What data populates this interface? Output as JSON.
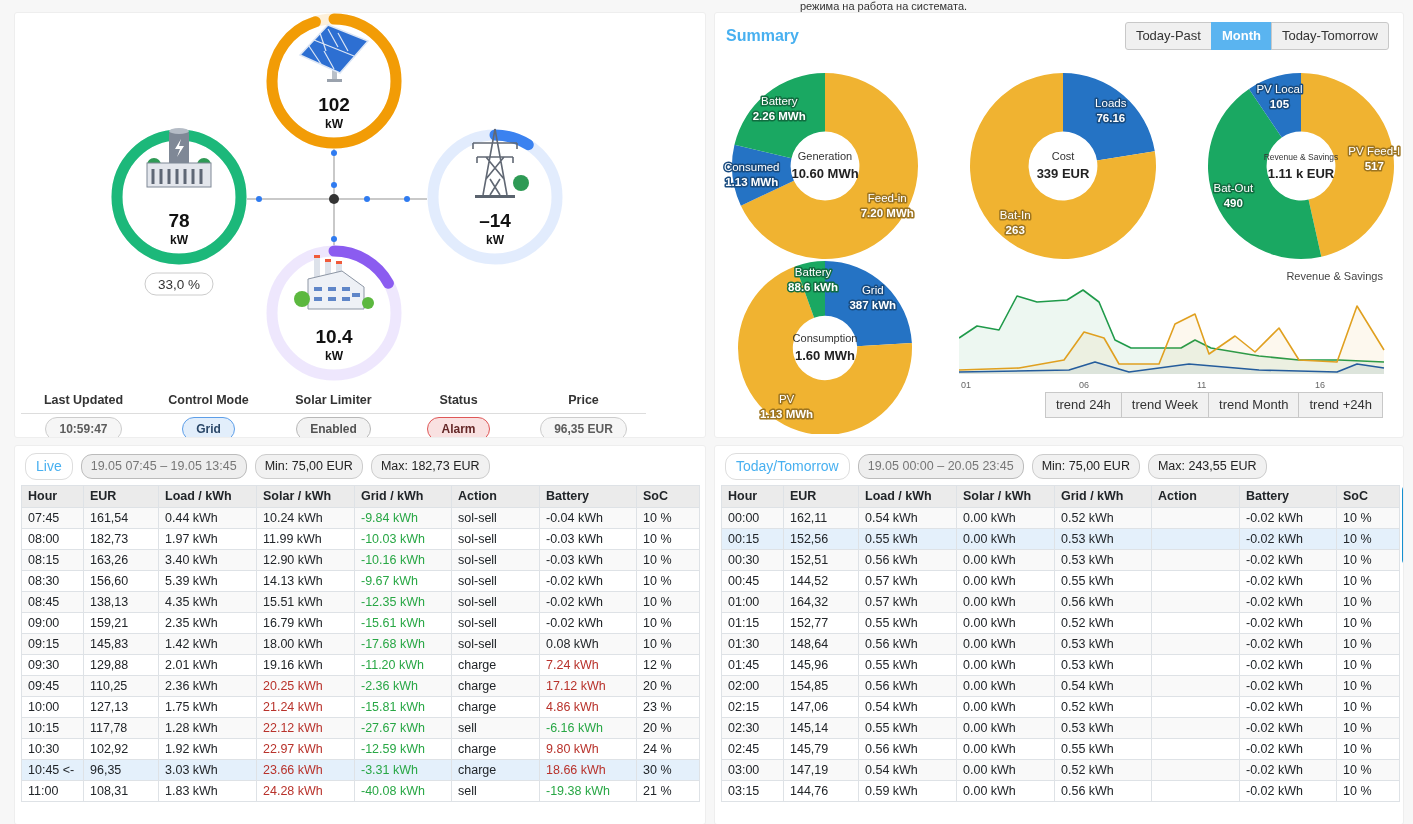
{
  "top_note": "режима на работа на системата.",
  "flow": {
    "nodes": [
      {
        "kind": "solar",
        "value": "102",
        "unit": "kW"
      },
      {
        "kind": "battery",
        "value": "78",
        "unit": "kW",
        "soc": "33,0 %"
      },
      {
        "kind": "grid",
        "value": "–14",
        "unit": "kW"
      },
      {
        "kind": "load",
        "value": "10.4",
        "unit": "kW"
      }
    ]
  },
  "status": [
    {
      "label": "Last Updated",
      "value": "10:59:47",
      "color": "#cccccc"
    },
    {
      "label": "Control Mode",
      "value": "Grid",
      "color": "#5d9ee8"
    },
    {
      "label": "Solar Limiter",
      "value": "Enabled",
      "color": "#b8b8b8"
    },
    {
      "label": "Status",
      "value": "Alarm",
      "color": "#df5757"
    },
    {
      "label": "Price",
      "value": "96,35 EUR",
      "color": "#cccccc"
    }
  ],
  "summary": {
    "title": "Summary",
    "periods": [
      {
        "label": "Today-Past",
        "selected": false
      },
      {
        "label": "Month",
        "selected": true
      },
      {
        "label": "Today-Tomorrow",
        "selected": false
      }
    ],
    "donuts": [
      {
        "total": "10.60 MWh",
        "slices": [
          {
            "color": "#f0b331"
          },
          {
            "color": "#2573c4"
          },
          {
            "color": "#1aa862"
          }
        ],
        "chart_data": {
          "type": "donut",
          "title": "Generation",
          "categories": [
            "Feed-in",
            "Consumed",
            "Battery"
          ],
          "values": [
            7.2,
            1.13,
            2.26
          ],
          "value_labels": [
            "7.20 MWh",
            "1.13 MWh",
            "2.26 MWh"
          ]
        }
      },
      {
        "total": "339 EUR",
        "slices": [
          {
            "color": "#2573c4"
          },
          {
            "color": "#f0b331"
          }
        ],
        "chart_data": {
          "type": "donut",
          "title": "Cost",
          "categories": [
            "Loads",
            "Bat-In"
          ],
          "values": [
            76.16,
            263
          ],
          "value_labels": [
            "76.16",
            "263"
          ]
        }
      },
      {
        "total": "1.11 k EUR",
        "slices": [
          {
            "color": "#f0b331"
          },
          {
            "color": "#1aa862"
          },
          {
            "color": "#2573c4"
          }
        ],
        "chart_data": {
          "type": "donut",
          "title": "Revenue & Savings",
          "categories": [
            "PV Feed-I",
            "Bat-Out",
            "PV Local"
          ],
          "values": [
            517,
            490,
            105
          ],
          "value_labels": [
            "517",
            "490",
            "105"
          ]
        }
      },
      {
        "total": "1.60 MWh",
        "slices": [
          {
            "color": "#2573c4",
            "value_text": "387 kWh"
          },
          {
            "color": "#f0b331",
            "value_text": "1.13 MWh"
          },
          {
            "color": "#1aa862",
            "value_text": "88.6 kWh"
          }
        ],
        "chart_data": {
          "type": "donut",
          "title": "Consumption",
          "categories": [
            "Grid",
            "PV",
            "Battery"
          ],
          "values": [
            24.1,
            70.4,
            5.5
          ]
        }
      }
    ],
    "trend": {
      "title": "Revenue & Savings",
      "x_labels": [
        "01",
        "06",
        "11",
        "16"
      ],
      "buttons": [
        {
          "label": "trend 24h",
          "selected": false
        },
        {
          "label": "trend Week",
          "selected": false
        },
        {
          "label": "trend Month",
          "selected": false
        },
        {
          "label": "trend +24h",
          "selected": false
        }
      ]
    }
  },
  "tables": [
    {
      "title": "Live",
      "range": "19.05 07:45 – 19.05 13:45",
      "min": "Min: 75,00 EUR",
      "max": "Max: 182,73 EUR",
      "columns": [
        "Hour",
        "EUR",
        "Load / kWh",
        "Solar / kWh",
        "Grid / kWh",
        "Action",
        "Battery",
        "SoC"
      ],
      "rows": [
        {
          "selected": false,
          "cells": [
            "07:45",
            "161,54",
            "0.44 kWh",
            "10.24 kWh",
            {
              "text": "-9.84 kWh",
              "color": "#28a745"
            },
            "sol-sell",
            "-0.04 kWh",
            "10 %"
          ]
        },
        {
          "selected": false,
          "cells": [
            "08:00",
            "182,73",
            "1.97 kWh",
            "11.99 kWh",
            {
              "text": "-10.03 kWh",
              "color": "#28a745"
            },
            "sol-sell",
            "-0.03 kWh",
            "10 %"
          ]
        },
        {
          "selected": false,
          "cells": [
            "08:15",
            "163,26",
            "3.40 kWh",
            "12.90 kWh",
            {
              "text": "-10.16 kWh",
              "color": "#28a745"
            },
            "sol-sell",
            "-0.03 kWh",
            "10 %"
          ]
        },
        {
          "selected": false,
          "cells": [
            "08:30",
            "156,60",
            "5.39 kWh",
            "14.13 kWh",
            {
              "text": "-9.67 kWh",
              "color": "#28a745"
            },
            "sol-sell",
            "-0.02 kWh",
            "10 %"
          ]
        },
        {
          "selected": false,
          "cells": [
            "08:45",
            "138,13",
            "4.35 kWh",
            "15.51 kWh",
            {
              "text": "-12.35 kWh",
              "color": "#28a745"
            },
            "sol-sell",
            "-0.02 kWh",
            "10 %"
          ]
        },
        {
          "selected": false,
          "cells": [
            "09:00",
            "159,21",
            "2.35 kWh",
            "16.79 kWh",
            {
              "text": "-15.61 kWh",
              "color": "#28a745"
            },
            "sol-sell",
            "-0.02 kWh",
            "10 %"
          ]
        },
        {
          "selected": false,
          "cells": [
            "09:15",
            "145,83",
            "1.42 kWh",
            "18.00 kWh",
            {
              "text": "-17.68 kWh",
              "color": "#28a745"
            },
            "sol-sell",
            "0.08 kWh",
            "10 %"
          ]
        },
        {
          "selected": false,
          "cells": [
            "09:30",
            "129,88",
            "2.01 kWh",
            "19.16 kWh",
            {
              "text": "-11.20 kWh",
              "color": "#28a745"
            },
            "charge",
            {
              "text": "7.24 kWh",
              "color": "#b8322b"
            },
            "12 %"
          ]
        },
        {
          "selected": false,
          "cells": [
            "09:45",
            "110,25",
            "2.36 kWh",
            {
              "text": "20.25 kWh",
              "color": "#b8322b"
            },
            {
              "text": "-2.36 kWh",
              "color": "#28a745"
            },
            "charge",
            {
              "text": "17.12 kWh",
              "color": "#b8322b"
            },
            "20 %"
          ]
        },
        {
          "selected": false,
          "cells": [
            "10:00",
            "127,13",
            "1.75 kWh",
            {
              "text": "21.24 kWh",
              "color": "#b8322b"
            },
            {
              "text": "-15.81 kWh",
              "color": "#28a745"
            },
            "charge",
            {
              "text": "4.86 kWh",
              "color": "#b8322b"
            },
            "23 %"
          ]
        },
        {
          "selected": false,
          "cells": [
            "10:15",
            "117,78",
            "1.28 kWh",
            {
              "text": "22.12 kWh",
              "color": "#b8322b"
            },
            {
              "text": "-27.67 kWh",
              "color": "#28a745"
            },
            "sell",
            {
              "text": "-6.16 kWh",
              "color": "#28a745"
            },
            "20 %"
          ]
        },
        {
          "selected": false,
          "cells": [
            "10:30",
            "102,92",
            "1.92 kWh",
            {
              "text": "22.97 kWh",
              "color": "#b8322b"
            },
            {
              "text": "-12.59 kWh",
              "color": "#28a745"
            },
            "charge",
            {
              "text": "9.80 kWh",
              "color": "#b8322b"
            },
            "24 %"
          ]
        },
        {
          "selected": true,
          "cells": [
            "10:45 <-",
            "96,35",
            "3.03 kWh",
            {
              "text": "23.66 kWh",
              "color": "#b8322b"
            },
            {
              "text": "-3.31 kWh",
              "color": "#28a745"
            },
            "charge",
            {
              "text": "18.66 kWh",
              "color": "#b8322b"
            },
            "30 %"
          ]
        },
        {
          "selected": false,
          "cells": [
            "11:00",
            "108,31",
            "1.83 kWh",
            {
              "text": "24.28 kWh",
              "color": "#b8322b"
            },
            {
              "text": "-40.08 kWh",
              "color": "#28a745"
            },
            "sell",
            {
              "text": "-19.38 kWh",
              "color": "#28a745"
            },
            "21 %"
          ]
        }
      ]
    },
    {
      "title": "Today/Tomorrow",
      "range": "19.05 00:00 – 20.05 23:45",
      "min": "Min: 75,00 EUR",
      "max": "Max: 243,55 EUR",
      "scrollbar": true,
      "columns": [
        "Hour",
        "EUR",
        "Load / kWh",
        "Solar / kWh",
        "Grid / kWh",
        "Action",
        "Battery",
        "SoC"
      ],
      "rows": [
        {
          "selected": false,
          "cells": [
            "00:00",
            "162,11",
            "0.54 kWh",
            "0.00 kWh",
            "0.52 kWh",
            null,
            "-0.02 kWh",
            "10 %"
          ]
        },
        {
          "selected": true,
          "cells": [
            "00:15",
            "152,56",
            "0.55 kWh",
            "0.00 kWh",
            "0.53 kWh",
            null,
            "-0.02 kWh",
            "10 %"
          ]
        },
        {
          "selected": false,
          "cells": [
            "00:30",
            "152,51",
            "0.56 kWh",
            "0.00 kWh",
            "0.53 kWh",
            null,
            "-0.02 kWh",
            "10 %"
          ]
        },
        {
          "selected": false,
          "cells": [
            "00:45",
            "144,52",
            "0.57 kWh",
            "0.00 kWh",
            "0.55 kWh",
            null,
            "-0.02 kWh",
            "10 %"
          ]
        },
        {
          "selected": false,
          "cells": [
            "01:00",
            "164,32",
            "0.57 kWh",
            "0.00 kWh",
            "0.56 kWh",
            null,
            "-0.02 kWh",
            "10 %"
          ]
        },
        {
          "selected": false,
          "cells": [
            "01:15",
            "152,77",
            "0.55 kWh",
            "0.00 kWh",
            "0.52 kWh",
            null,
            "-0.02 kWh",
            "10 %"
          ]
        },
        {
          "selected": false,
          "cells": [
            "01:30",
            "148,64",
            "0.56 kWh",
            "0.00 kWh",
            "0.53 kWh",
            null,
            "-0.02 kWh",
            "10 %"
          ]
        },
        {
          "selected": false,
          "cells": [
            "01:45",
            "145,96",
            "0.55 kWh",
            "0.00 kWh",
            "0.53 kWh",
            null,
            "-0.02 kWh",
            "10 %"
          ]
        },
        {
          "selected": false,
          "cells": [
            "02:00",
            "154,85",
            "0.56 kWh",
            "0.00 kWh",
            "0.54 kWh",
            null,
            "-0.02 kWh",
            "10 %"
          ]
        },
        {
          "selected": false,
          "cells": [
            "02:15",
            "147,06",
            "0.54 kWh",
            "0.00 kWh",
            "0.52 kWh",
            null,
            "-0.02 kWh",
            "10 %"
          ]
        },
        {
          "selected": false,
          "cells": [
            "02:30",
            "145,14",
            "0.55 kWh",
            "0.00 kWh",
            "0.53 kWh",
            null,
            "-0.02 kWh",
            "10 %"
          ]
        },
        {
          "selected": false,
          "cells": [
            "02:45",
            "145,79",
            "0.56 kWh",
            "0.00 kWh",
            "0.55 kWh",
            null,
            "-0.02 kWh",
            "10 %"
          ]
        },
        {
          "selected": false,
          "cells": [
            "03:00",
            "147,19",
            "0.54 kWh",
            "0.00 kWh",
            "0.52 kWh",
            null,
            "-0.02 kWh",
            "10 %"
          ]
        },
        {
          "selected": false,
          "cells": [
            "03:15",
            "144,76",
            "0.59 kWh",
            "0.00 kWh",
            "0.56 kWh",
            null,
            "-0.02 kWh",
            "10 %"
          ]
        }
      ]
    }
  ]
}
